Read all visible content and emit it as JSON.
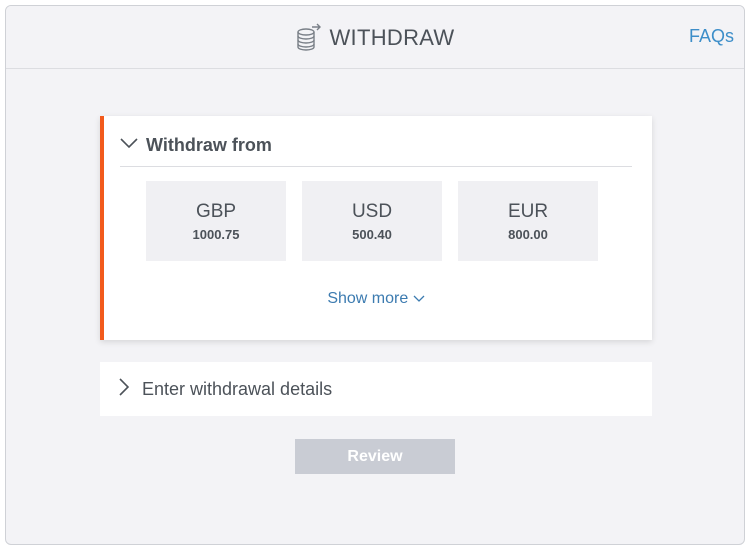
{
  "header": {
    "title": "WITHDRAW",
    "title_icon": "coins-icon",
    "faqs_label": "FAQs"
  },
  "withdraw_from": {
    "heading": "Withdraw from",
    "expanded": true,
    "accounts": [
      {
        "currency": "GBP",
        "amount": "1000.75"
      },
      {
        "currency": "USD",
        "amount": "500.40"
      },
      {
        "currency": "EUR",
        "amount": "800.00"
      }
    ],
    "show_more_label": "Show more"
  },
  "details_section": {
    "label": "Enter withdrawal details",
    "expanded": false
  },
  "actions": {
    "review_label": "Review"
  },
  "colors": {
    "accent": "#f25a1c",
    "link": "#3d8ec9",
    "button_disabled": "#c9ccd4"
  }
}
